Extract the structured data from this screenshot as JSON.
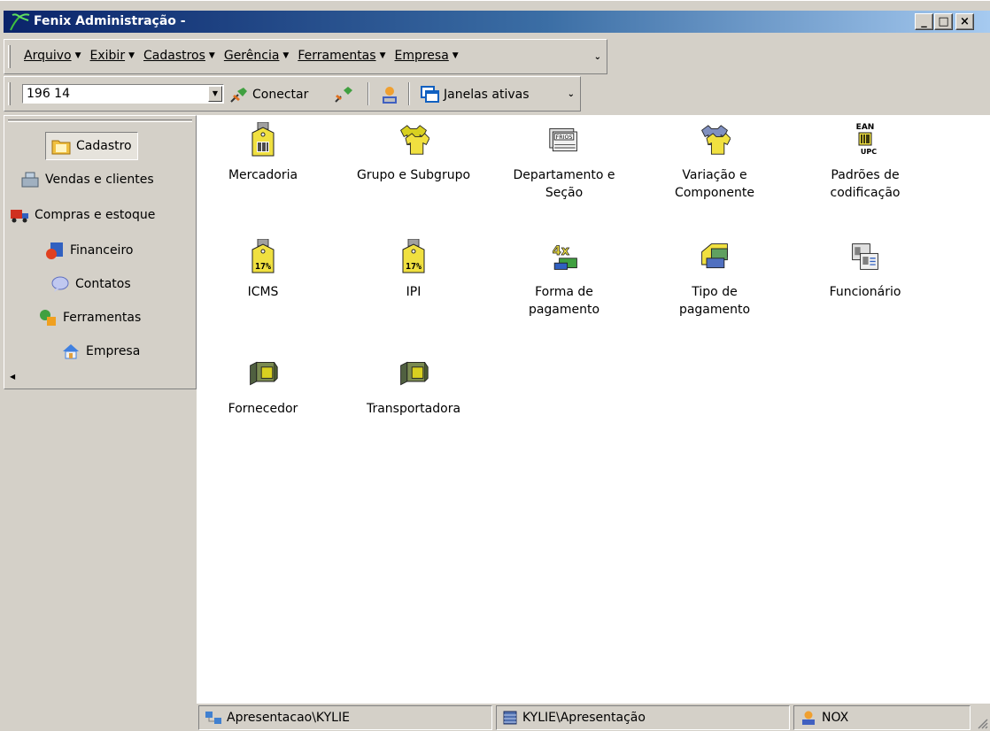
{
  "window": {
    "title": "Fenix Administração -",
    "minimize": "_",
    "maximize": "□",
    "close": "×"
  },
  "menubar": {
    "items": [
      {
        "label": "Arquivo",
        "icon": "caret-down-icon"
      },
      {
        "label": "Exibir",
        "icon": "caret-down-icon"
      },
      {
        "label": "Cadastros",
        "icon": "caret-down-icon"
      },
      {
        "label": "Gerência",
        "icon": "caret-down-icon"
      },
      {
        "label": "Ferramentas",
        "icon": "caret-down-icon"
      },
      {
        "label": "Empresa",
        "icon": "caret-down-icon"
      }
    ]
  },
  "toolbar": {
    "combo_value": "196 14",
    "connect_label": "Conectar",
    "windows_label": "Janelas ativas"
  },
  "sidebar": {
    "items": [
      {
        "label": "Cadastro",
        "icon": "folder-icon",
        "active": true
      },
      {
        "label": "Vendas e clientes",
        "icon": "cash-register-icon"
      },
      {
        "label": "Compras e estoque",
        "icon": "truck-icon"
      },
      {
        "label": "Financeiro",
        "icon": "finance-icon"
      },
      {
        "label": "Contatos",
        "icon": "speech-bubble-icon"
      },
      {
        "label": "Ferramentas",
        "icon": "tools-icon"
      },
      {
        "label": "Empresa",
        "icon": "house-icon"
      }
    ]
  },
  "content": {
    "tiles": [
      {
        "label": "Mercadoria",
        "icon": "barcode-tag-icon"
      },
      {
        "label": "Grupo e Subgrupo",
        "icon": "shirts-icon"
      },
      {
        "label": "Departamento e\nSeção",
        "icon": "frios-sign-icon"
      },
      {
        "label": "Variação e\nComponente",
        "icon": "shirt-variation-icon"
      },
      {
        "label": "Padrões de\ncodificação",
        "icon": "ean-upc-icon"
      },
      {
        "label": "ICMS",
        "icon": "tax-tag-icon"
      },
      {
        "label": "IPI",
        "icon": "tax-tag-icon"
      },
      {
        "label": "Forma de\npagamento",
        "icon": "payment-4x-icon"
      },
      {
        "label": "Tipo de\npagamento",
        "icon": "payment-type-icon"
      },
      {
        "label": "Funcionário",
        "icon": "id-cards-icon"
      },
      {
        "label": "Fornecedor",
        "icon": "supplier-truck-icon"
      },
      {
        "label": "Transportadora",
        "icon": "carrier-truck-icon"
      }
    ]
  },
  "statusbar": {
    "pane1": "Apresentacao\\KYLIE",
    "pane2": "KYLIE\\Apresentação",
    "pane3": "NOX"
  },
  "colors": {
    "titlebar_start": "#0a246a",
    "titlebar_end": "#a6caf0",
    "chrome": "#d4d0c8",
    "icon_yellow": "#f0e040"
  }
}
